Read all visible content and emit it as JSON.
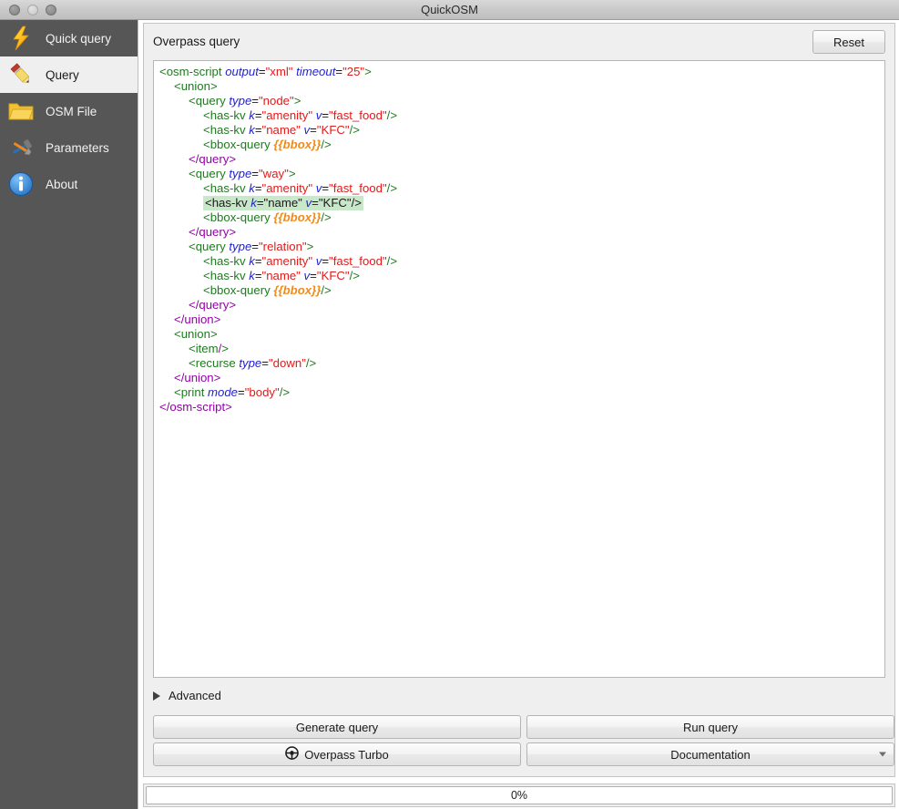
{
  "window": {
    "title": "QuickOSM",
    "controls": [
      "close-button",
      "minimize-button",
      "zoom-button"
    ]
  },
  "sidebar": {
    "items": [
      {
        "label": "Quick query",
        "icon": "lightning-bolt-icon",
        "selected": false
      },
      {
        "label": "Query",
        "icon": "pencil-icon",
        "selected": true
      },
      {
        "label": "OSM File",
        "icon": "folder-icon",
        "selected": false
      },
      {
        "label": "Parameters",
        "icon": "tools-icon",
        "selected": false
      },
      {
        "label": "About",
        "icon": "info-circle-icon",
        "selected": false
      }
    ]
  },
  "panel": {
    "title": "Overpass query",
    "reset_label": "Reset",
    "advanced_label": "Advanced",
    "advanced_expanded": false
  },
  "editor": {
    "highlighted_line_index": 8,
    "lines": [
      {
        "indent": 0,
        "tokens": [
          {
            "t": "tg",
            "s": "<osm-script "
          },
          {
            "t": "at",
            "s": "output"
          },
          {
            "t": "eq",
            "s": "="
          },
          {
            "t": "vl",
            "s": "\"xml\""
          },
          {
            "t": "eq",
            "s": " "
          },
          {
            "t": "at",
            "s": "timeout"
          },
          {
            "t": "eq",
            "s": "="
          },
          {
            "t": "vl",
            "s": "\"25\""
          },
          {
            "t": "tg",
            "s": ">"
          }
        ]
      },
      {
        "indent": 1,
        "tokens": [
          {
            "t": "tg",
            "s": "<union>"
          }
        ]
      },
      {
        "indent": 2,
        "tokens": [
          {
            "t": "tg",
            "s": "<query "
          },
          {
            "t": "at",
            "s": "type"
          },
          {
            "t": "eq",
            "s": "="
          },
          {
            "t": "vl",
            "s": "\"node\""
          },
          {
            "t": "tg",
            "s": ">"
          }
        ]
      },
      {
        "indent": 3,
        "tokens": [
          {
            "t": "tg",
            "s": "<has-kv "
          },
          {
            "t": "at",
            "s": "k"
          },
          {
            "t": "eq",
            "s": "="
          },
          {
            "t": "vl",
            "s": "\"amenity\""
          },
          {
            "t": "eq",
            "s": " "
          },
          {
            "t": "at",
            "s": "v"
          },
          {
            "t": "eq",
            "s": "="
          },
          {
            "t": "vl",
            "s": "\"fast_food\""
          },
          {
            "t": "tg",
            "s": "/>"
          }
        ]
      },
      {
        "indent": 3,
        "tokens": [
          {
            "t": "tg",
            "s": "<has-kv "
          },
          {
            "t": "at",
            "s": "k"
          },
          {
            "t": "eq",
            "s": "="
          },
          {
            "t": "vl",
            "s": "\"name\""
          },
          {
            "t": "eq",
            "s": " "
          },
          {
            "t": "at",
            "s": "v"
          },
          {
            "t": "eq",
            "s": "="
          },
          {
            "t": "vl",
            "s": "\"KFC\""
          },
          {
            "t": "tg",
            "s": "/>"
          }
        ]
      },
      {
        "indent": 3,
        "tokens": [
          {
            "t": "tg",
            "s": "<bbox-query "
          },
          {
            "t": "bb",
            "s": "{{bbox}}"
          },
          {
            "t": "tg",
            "s": "/>"
          }
        ]
      },
      {
        "indent": 2,
        "tokens": [
          {
            "t": "ctg",
            "s": "</query>"
          }
        ]
      },
      {
        "indent": 2,
        "tokens": [
          {
            "t": "tg",
            "s": "<query "
          },
          {
            "t": "at",
            "s": "type"
          },
          {
            "t": "eq",
            "s": "="
          },
          {
            "t": "vl",
            "s": "\"way\""
          },
          {
            "t": "tg",
            "s": ">"
          }
        ]
      },
      {
        "indent": 3,
        "tokens": [
          {
            "t": "tg",
            "s": "<has-kv "
          },
          {
            "t": "at",
            "s": "k"
          },
          {
            "t": "eq",
            "s": "="
          },
          {
            "t": "vl",
            "s": "\"amenity\""
          },
          {
            "t": "eq",
            "s": " "
          },
          {
            "t": "at",
            "s": "v"
          },
          {
            "t": "eq",
            "s": "="
          },
          {
            "t": "vl",
            "s": "\"fast_food\""
          },
          {
            "t": "tg",
            "s": "/>"
          }
        ]
      },
      {
        "indent": 3,
        "highlight": true,
        "tokens": [
          {
            "t": "eq",
            "s": "<has-kv "
          },
          {
            "t": "at",
            "s": "k"
          },
          {
            "t": "eq",
            "s": "="
          },
          {
            "t": "eq",
            "s": "\"name\""
          },
          {
            "t": "eq",
            "s": " "
          },
          {
            "t": "at",
            "s": "v"
          },
          {
            "t": "eq",
            "s": "="
          },
          {
            "t": "eq",
            "s": "\"KFC\""
          },
          {
            "t": "eq",
            "s": "/>"
          }
        ]
      },
      {
        "indent": 3,
        "tokens": [
          {
            "t": "tg",
            "s": "<bbox-query "
          },
          {
            "t": "bb",
            "s": "{{bbox}}"
          },
          {
            "t": "tg",
            "s": "/>"
          }
        ]
      },
      {
        "indent": 2,
        "tokens": [
          {
            "t": "ctg",
            "s": "</query>"
          }
        ]
      },
      {
        "indent": 2,
        "tokens": [
          {
            "t": "tg",
            "s": "<query "
          },
          {
            "t": "at",
            "s": "type"
          },
          {
            "t": "eq",
            "s": "="
          },
          {
            "t": "vl",
            "s": "\"relation\""
          },
          {
            "t": "tg",
            "s": ">"
          }
        ]
      },
      {
        "indent": 3,
        "tokens": [
          {
            "t": "tg",
            "s": "<has-kv "
          },
          {
            "t": "at",
            "s": "k"
          },
          {
            "t": "eq",
            "s": "="
          },
          {
            "t": "vl",
            "s": "\"amenity\""
          },
          {
            "t": "eq",
            "s": " "
          },
          {
            "t": "at",
            "s": "v"
          },
          {
            "t": "eq",
            "s": "="
          },
          {
            "t": "vl",
            "s": "\"fast_food\""
          },
          {
            "t": "tg",
            "s": "/>"
          }
        ]
      },
      {
        "indent": 3,
        "tokens": [
          {
            "t": "tg",
            "s": "<has-kv "
          },
          {
            "t": "at",
            "s": "k"
          },
          {
            "t": "eq",
            "s": "="
          },
          {
            "t": "vl",
            "s": "\"name\""
          },
          {
            "t": "eq",
            "s": " "
          },
          {
            "t": "at",
            "s": "v"
          },
          {
            "t": "eq",
            "s": "="
          },
          {
            "t": "vl",
            "s": "\"KFC\""
          },
          {
            "t": "tg",
            "s": "/>"
          }
        ]
      },
      {
        "indent": 3,
        "tokens": [
          {
            "t": "tg",
            "s": "<bbox-query "
          },
          {
            "t": "bb",
            "s": "{{bbox}}"
          },
          {
            "t": "tg",
            "s": "/>"
          }
        ]
      },
      {
        "indent": 2,
        "tokens": [
          {
            "t": "ctg",
            "s": "</query>"
          }
        ]
      },
      {
        "indent": 1,
        "tokens": [
          {
            "t": "ctg",
            "s": "</union>"
          }
        ]
      },
      {
        "indent": 1,
        "tokens": [
          {
            "t": "tg",
            "s": "<union>"
          }
        ]
      },
      {
        "indent": 2,
        "tokens": [
          {
            "t": "tg",
            "s": "<item"
          },
          {
            "t": "ctg",
            "s": "/"
          },
          {
            "t": "tg",
            "s": ">"
          }
        ]
      },
      {
        "indent": 2,
        "tokens": [
          {
            "t": "tg",
            "s": "<recurse "
          },
          {
            "t": "at",
            "s": "type"
          },
          {
            "t": "eq",
            "s": "="
          },
          {
            "t": "vl",
            "s": "\"down\""
          },
          {
            "t": "tg",
            "s": "/>"
          }
        ]
      },
      {
        "indent": 1,
        "tokens": [
          {
            "t": "ctg",
            "s": "</union>"
          }
        ]
      },
      {
        "indent": 1,
        "tokens": [
          {
            "t": "tg",
            "s": "<print "
          },
          {
            "t": "at",
            "s": "mode"
          },
          {
            "t": "eq",
            "s": "="
          },
          {
            "t": "vl",
            "s": "\"body\""
          },
          {
            "t": "tg",
            "s": "/>"
          }
        ]
      },
      {
        "indent": 0,
        "tokens": [
          {
            "t": "ctg",
            "s": "</osm-script>"
          }
        ]
      }
    ]
  },
  "actions": {
    "generate_query": "Generate query",
    "run_query": "Run query",
    "overpass_turbo": "Overpass Turbo",
    "documentation": "Documentation"
  },
  "progress": {
    "label": "0%",
    "value": 0
  },
  "colors": {
    "sidebar_bg": "#565656",
    "sidebar_selected_bg": "#efefef",
    "panel_bg": "#efefef",
    "editor_bg": "#ffffff",
    "tag": "#1f7a1f",
    "closing_tag": "#9400a8",
    "attribute": "#2222cc",
    "value": "#e01b1b",
    "placeholder": "#ef8a1a",
    "line_highlight": "#c9e7c9"
  }
}
